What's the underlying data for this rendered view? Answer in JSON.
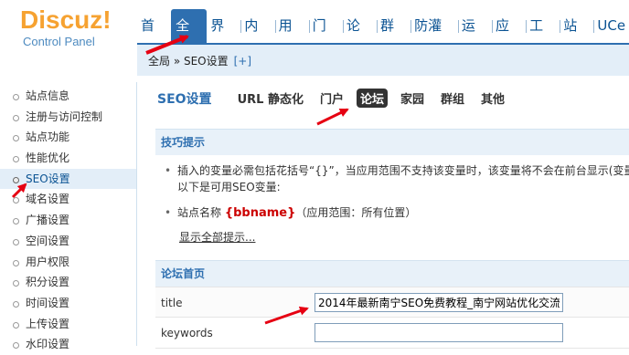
{
  "logo": {
    "brand": "Discuz",
    "exclaim": "!",
    "subtitle": "Control Panel"
  },
  "topnav": [
    "首页",
    "全局",
    "界面",
    "内容",
    "用户",
    "门户",
    "论坛",
    "群组",
    "防灌水",
    "运营",
    "应用",
    "工具",
    "站长",
    "UCe"
  ],
  "breadcrumb": {
    "path": "全局 » SEO设置",
    "plus": "[+]"
  },
  "sidebar": [
    "站点信息",
    "注册与访问控制",
    "站点功能",
    "性能优化",
    "SEO设置",
    "域名设置",
    "广播设置",
    "空间设置",
    "用户权限",
    "积分设置",
    "时间设置",
    "上传设置",
    "水印设置"
  ],
  "subnav": {
    "title": "SEO设置",
    "items": [
      "URL 静态化",
      "门户",
      "论坛",
      "家园",
      "群组",
      "其他"
    ]
  },
  "tips": {
    "head": "技巧提示",
    "line1": "插入的变量必需包括花括号“{}”，当应用范围不支持该变量时，该变量将不会在前台显示(变量后边",
    "line2": "以下是可用SEO变量:",
    "var_prefix": "站点名称 ",
    "var_name": "{bbname}",
    "var_suffix": "（应用范围：所有位置）",
    "show_all": "显示全部提示..."
  },
  "forum": {
    "head": "论坛首页",
    "title_label": "title",
    "title_value": "2014年最新南宁SEO免费教程_南宁网站优化交流论",
    "keywords_label": "keywords",
    "keywords_value": ""
  },
  "colors": {
    "accent": "#2e6fb0",
    "arrow": "#e60012",
    "logo": "#f6a231"
  }
}
